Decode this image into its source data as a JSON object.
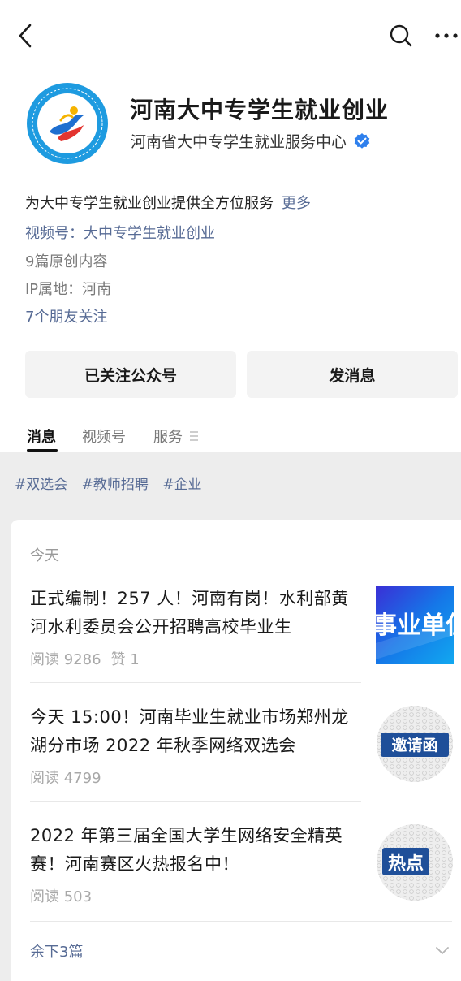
{
  "topbar": {
    "back_icon": "chevron-left-icon",
    "search_icon": "search-icon",
    "more_icon": "more-dots-icon"
  },
  "account": {
    "name": "河南大中专学生就业创业",
    "org": "河南省大中专学生就业服务中心",
    "intro": "为大中专学生就业创业提供全方位服务",
    "more_link": "更多",
    "video_channel": "视频号：大中专学生就业创业",
    "original_count": "9篇原创内容",
    "ip_location": "IP属地：河南",
    "friends_following": "7个朋友关注"
  },
  "buttons": {
    "followed": "已关注公众号",
    "message": "发消息"
  },
  "tabs": [
    {
      "label": "消息"
    },
    {
      "label": "视频号"
    },
    {
      "label": "服务"
    }
  ],
  "tags": [
    "#双选会",
    "#教师招聘",
    "#企业"
  ],
  "section_label": "今天",
  "articles": [
    {
      "title": "正式编制！257 人！河南有岗！水利部黄河水利委员会公开招聘高校毕业生",
      "reads": "阅读 9286",
      "likes": "赞 1",
      "thumb_text": "事业单位"
    },
    {
      "title": "今天 15:00！河南毕业生就业市场郑州龙湖分市场 2022 年秋季网络双选会",
      "reads": "阅读 4799",
      "thumb_text": "邀请函"
    },
    {
      "title": "2022 年第三届全国大学生网络安全精英赛！河南赛区火热报名中！",
      "reads": "阅读 503",
      "thumb_text": "热点"
    }
  ],
  "remaining": "余下3篇",
  "colors": {
    "link": "#576b95",
    "accent_blue": "#1a6fd6",
    "gray_bg": "#ededed"
  }
}
